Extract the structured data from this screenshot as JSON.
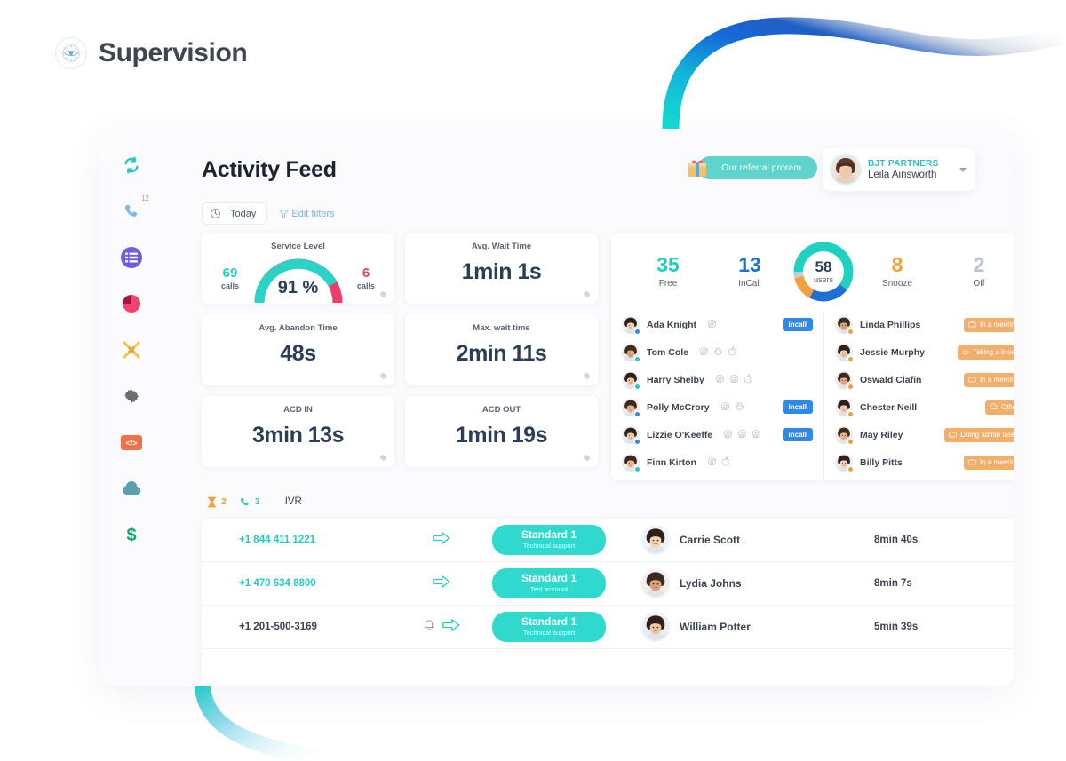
{
  "brand": {
    "name": "Supervision",
    "logo_icon": "eye-target-icon"
  },
  "header": {
    "title": "Activity Feed",
    "date_filter": {
      "label": "Today",
      "icon": "clock-icon"
    },
    "edit_filters": {
      "label": "Edit filters",
      "icon": "funnel-icon"
    },
    "referral": {
      "label": "Our referral proram",
      "icon": "gift-icon"
    },
    "account": {
      "org": "BJT PARTNERS",
      "user": "Leila Ainsworth",
      "caret_icon": "chevron-down-icon"
    }
  },
  "rail": {
    "items": [
      {
        "name": "sync",
        "icon": "sync-circle-icon",
        "badge": ""
      },
      {
        "name": "calls",
        "icon": "phone-icon",
        "badge": "12"
      },
      {
        "name": "lists",
        "icon": "list-icon",
        "badge": ""
      },
      {
        "name": "stats",
        "icon": "pie-chart-icon",
        "badge": ""
      },
      {
        "name": "routing",
        "icon": "crossed-arrows-icon",
        "badge": ""
      },
      {
        "name": "settings",
        "icon": "gear-icon",
        "badge": ""
      },
      {
        "name": "developer",
        "icon": "code-icon",
        "badge": ""
      },
      {
        "name": "cloud",
        "icon": "cloud-icon",
        "badge": ""
      },
      {
        "name": "billing",
        "icon": "dollar-icon",
        "badge": ""
      }
    ]
  },
  "metrics": {
    "service_level": {
      "title": "Service Level",
      "percent": "91 %",
      "answered": {
        "value": "69",
        "label": "calls",
        "color": "#2ac9c0"
      },
      "abandoned": {
        "value": "6",
        "label": "calls",
        "color": "#ee3e6b"
      },
      "gauge_fill_pct": 91
    },
    "cards": [
      {
        "title": "Avg. Wait Time",
        "value": "1min 1s"
      },
      {
        "title": "Avg. Abandon Time",
        "value": "48s"
      },
      {
        "title": "Max. wait time",
        "value": "2min 11s"
      },
      {
        "title": "ACD IN",
        "value": "3min 13s"
      },
      {
        "title": "ACD OUT",
        "value": "1min 19s"
      }
    ]
  },
  "agents": {
    "stats": [
      {
        "value": "35",
        "label": "Free",
        "color": "#2ac9c0"
      },
      {
        "value": "13",
        "label": "InCall",
        "color": "#1f6fd4"
      }
    ],
    "stats_right": [
      {
        "value": "8",
        "label": "Snooze",
        "color": "#f0a03c"
      },
      {
        "value": "2",
        "label": "Off",
        "color": "#b9c1cc"
      }
    ],
    "donut": {
      "total": "58",
      "unit": "users",
      "segments": [
        {
          "label": "Free",
          "value": 35,
          "color": "#1fd1c0"
        },
        {
          "label": "InCall",
          "value": 13,
          "color": "#1f6fd4"
        },
        {
          "label": "Snooze",
          "value": 8,
          "color": "#f0a03c"
        },
        {
          "label": "Off",
          "value": 2,
          "color": "#c6ced8"
        }
      ]
    },
    "left_list": [
      {
        "name": "Ada Knight",
        "dot": "#2e8ae6",
        "browsers": [
          "chrome"
        ],
        "tag": "incall",
        "tag_type": "incall"
      },
      {
        "name": "Tom Cole",
        "dot": "#2ac9c0",
        "browsers": [
          "chrome",
          "android",
          "apple"
        ],
        "tag": "",
        "tag_type": ""
      },
      {
        "name": "Harry Shelby",
        "dot": "#2ac9c0",
        "browsers": [
          "chrome",
          "chrome",
          "apple"
        ],
        "tag": "",
        "tag_type": ""
      },
      {
        "name": "Polly McCrory",
        "dot": "#2e8ae6",
        "browsers": [
          "chrome",
          "android"
        ],
        "tag": "incall",
        "tag_type": "incall"
      },
      {
        "name": "Lizzie O'Keeffe",
        "dot": "#2e8ae6",
        "browsers": [
          "chrome",
          "chrome",
          "chrome"
        ],
        "tag": "incall",
        "tag_type": "incall"
      },
      {
        "name": "Finn Kirton",
        "dot": "#2ac9c0",
        "browsers": [
          "chrome",
          "apple"
        ],
        "tag": "",
        "tag_type": ""
      }
    ],
    "right_list": [
      {
        "name": "Linda Phillips",
        "dot": "#f0a03c",
        "tag": "In a meeting",
        "tag_icon": "briefcase-icon"
      },
      {
        "name": "Jessie Murphy",
        "dot": "#f0a03c",
        "tag": "Taking a break",
        "tag_icon": "coffee-icon"
      },
      {
        "name": "Oswald Clafin",
        "dot": "#f0a03c",
        "tag": "In a meeting",
        "tag_icon": "briefcase-icon"
      },
      {
        "name": "Chester Neill",
        "dot": "#f0a03c",
        "tag": "Other",
        "tag_icon": "cloud-icon"
      },
      {
        "name": "May Riley",
        "dot": "#f0a03c",
        "tag": "Doing admin tasks",
        "tag_icon": "folder-icon"
      },
      {
        "name": "Billy Pitts",
        "dot": "#f0a03c",
        "tag": "In a meeting",
        "tag_icon": "briefcase-icon"
      }
    ]
  },
  "calls": {
    "tabs": [
      {
        "icon": "hourglass-icon",
        "count": "2",
        "color": "#f0a03c"
      },
      {
        "icon": "phone-icon",
        "count": "3",
        "color": "#2ac9c0"
      }
    ],
    "ivr_label": "IVR",
    "rows": [
      {
        "number": "+1 844 411 1221",
        "number_color": "#2ac9c0",
        "icons": [
          "arrow-right-icon"
        ],
        "queue": "Standard 1",
        "queue_sub": "Technical support",
        "agent": "Carrie Scott",
        "duration": "8min 40s"
      },
      {
        "number": "+1 470 634 8800",
        "number_color": "#2ac9c0",
        "icons": [
          "arrow-right-icon"
        ],
        "queue": "Standard 1",
        "queue_sub": "Test account",
        "agent": "Lydia Johns",
        "duration": "8min 7s"
      },
      {
        "number": "+1 201-500-3169",
        "number_color": "#3b4450",
        "icons": [
          "bell-icon",
          "arrow-right-icon"
        ],
        "queue": "Standard 1",
        "queue_sub": "Technical support",
        "agent": "William Potter",
        "duration": "5min 39s"
      }
    ]
  },
  "colors": {
    "teal": "#2ac9c0",
    "blue": "#2e8ae6",
    "orange": "#f0a03c",
    "pink": "#ee3e6b",
    "ink": "#2c3e56"
  }
}
